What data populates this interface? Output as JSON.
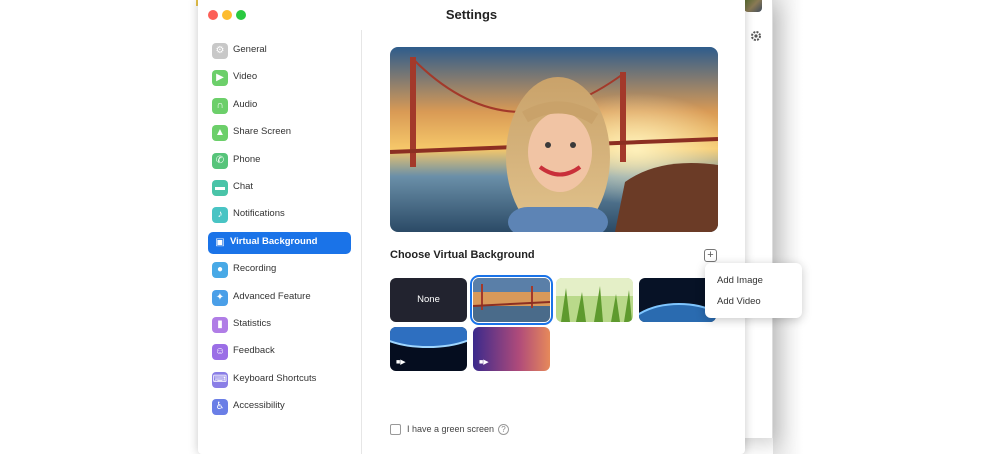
{
  "window": {
    "title": "Settings"
  },
  "sidebar": {
    "items": [
      {
        "label": "General",
        "icon": "gear-icon",
        "color": "#c8c8c8"
      },
      {
        "label": "Video",
        "icon": "video-camera-icon",
        "color": "#6ccf6a"
      },
      {
        "label": "Audio",
        "icon": "headphones-icon",
        "color": "#6ccf6a"
      },
      {
        "label": "Share Screen",
        "icon": "share-screen-icon",
        "color": "#6ccf6a"
      },
      {
        "label": "Phone",
        "icon": "phone-icon",
        "color": "#57c47a"
      },
      {
        "label": "Chat",
        "icon": "chat-icon",
        "color": "#49c4a8"
      },
      {
        "label": "Notifications",
        "icon": "bell-icon",
        "color": "#49c4c4"
      },
      {
        "label": "Virtual Background",
        "icon": "virtual-background-icon",
        "color": "#1a73e8",
        "active": true
      },
      {
        "label": "Recording",
        "icon": "record-icon",
        "color": "#48a9e6"
      },
      {
        "label": "Advanced Feature",
        "icon": "sparkle-icon",
        "color": "#4a9fe8"
      },
      {
        "label": "Statistics",
        "icon": "bar-chart-icon",
        "color": "#b07de6"
      },
      {
        "label": "Feedback",
        "icon": "smiley-icon",
        "color": "#9b6ee6"
      },
      {
        "label": "Keyboard Shortcuts",
        "icon": "keyboard-icon",
        "color": "#8a7ee6"
      },
      {
        "label": "Accessibility",
        "icon": "accessibility-icon",
        "color": "#6a7ee6"
      }
    ]
  },
  "main": {
    "section_title": "Choose Virtual Background",
    "add_icon": "plus-square-icon",
    "thumbnails": {
      "none_label": "None"
    },
    "green_screen_label": "I have a green screen",
    "help_glyph": "?"
  },
  "dropdown": {
    "items": [
      "Add Image",
      "Add Video"
    ]
  }
}
